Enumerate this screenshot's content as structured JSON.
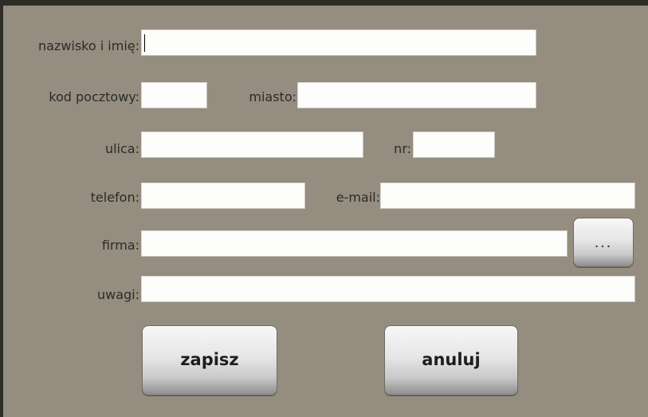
{
  "form": {
    "fullname_label": "nazwisko i imię:",
    "fullname_value": "",
    "postal_label": "kod pocztowy:",
    "postal_value": "",
    "city_label": "miasto:",
    "city_value": "",
    "street_label": "ulica:",
    "street_value": "",
    "number_label": "nr:",
    "number_value": "",
    "phone_label": "telefon:",
    "phone_value": "",
    "email_label": "e-mail:",
    "email_value": "",
    "company_label": "firma:",
    "company_value": "",
    "company_browse_label": "...",
    "notes_label": "uwagi:",
    "notes_value": ""
  },
  "actions": {
    "save_label": "zapisz",
    "cancel_label": "anuluj"
  },
  "colors": {
    "background": "#958d7f",
    "frame": "#2f2c28",
    "field": "#fdfdfc"
  }
}
